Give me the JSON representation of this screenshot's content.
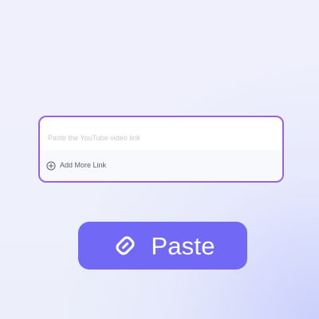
{
  "link_entry": {
    "placeholder": "Paste the YouTube video link",
    "add_more_label": "Add More Link",
    "add_icon": "plus-circle-icon"
  },
  "paste_button": {
    "label": "Paste",
    "icon": "link-icon"
  },
  "colors": {
    "accent": "#7169F5",
    "card_border": "#9A63D8",
    "text_muted": "#C8CAD3"
  }
}
